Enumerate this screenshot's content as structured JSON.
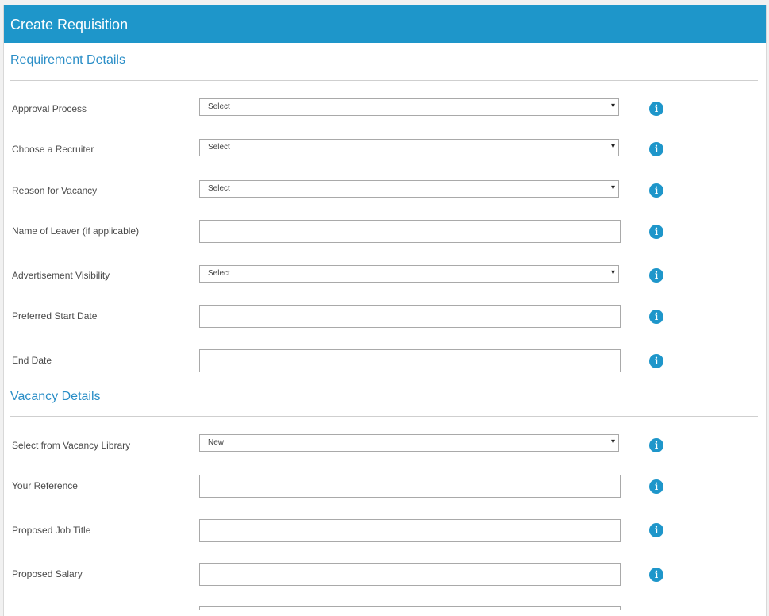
{
  "header": {
    "title": "Create Requisition"
  },
  "sections": {
    "requirement": "Requirement Details",
    "vacancy": "Vacancy Details"
  },
  "fields": {
    "approval_process": {
      "label": "Approval Process",
      "value": "Select"
    },
    "choose_recruiter": {
      "label": "Choose a Recruiter",
      "value": "Select"
    },
    "reason_for_vacancy": {
      "label": "Reason for Vacancy",
      "value": "Select"
    },
    "name_of_leaver": {
      "label": "Name of Leaver (if applicable)",
      "value": ""
    },
    "advertisement_visibility": {
      "label": "Advertisement Visibility",
      "value": "Select"
    },
    "preferred_start_date": {
      "label": "Preferred Start Date",
      "value": ""
    },
    "end_date": {
      "label": "End Date",
      "value": ""
    },
    "vacancy_library": {
      "label": "Select from Vacancy Library",
      "value": "New"
    },
    "your_reference": {
      "label": "Your Reference",
      "value": ""
    },
    "proposed_job_title": {
      "label": "Proposed Job Title",
      "value": ""
    },
    "proposed_salary": {
      "label": "Proposed Salary",
      "value": ""
    }
  },
  "icons": {
    "dropdown": "▾",
    "info": "i"
  },
  "colors": {
    "accent": "#1e96ca",
    "section_title": "#2a8ec7"
  }
}
